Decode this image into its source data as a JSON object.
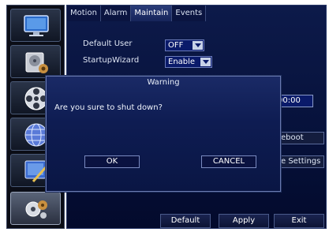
{
  "tabs": [
    {
      "label": "Motion"
    },
    {
      "label": "Alarm"
    },
    {
      "label": "Maintain"
    },
    {
      "label": "Events"
    }
  ],
  "settings": {
    "default_user": {
      "label": "Default User",
      "value": "OFF"
    },
    "startup_wizard": {
      "label": "StartupWizard",
      "value": "Enable"
    }
  },
  "right_panel": {
    "time_value": "00:00",
    "reboot_label": "eboot",
    "settings_label": "e Settings"
  },
  "bottom_buttons": {
    "default_label": "Default",
    "apply_label": "Apply",
    "exit_label": "Exit"
  },
  "dialog": {
    "title": "Warning",
    "message": "Are you sure to shut down?",
    "ok_label": "OK",
    "cancel_label": "CANCEL"
  },
  "sidebar": {
    "items": [
      {
        "icon": "monitor-icon"
      },
      {
        "icon": "hdd-gear-icon"
      },
      {
        "icon": "film-reel-icon"
      },
      {
        "icon": "network-globe-icon"
      },
      {
        "icon": "settings-tools-icon"
      },
      {
        "icon": "system-gears-icon"
      }
    ]
  }
}
